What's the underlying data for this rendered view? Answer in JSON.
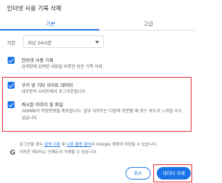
{
  "dialog": {
    "title": "인터넷 사용 기록 삭제"
  },
  "tabs": [
    {
      "label": "기본"
    },
    {
      "label": "고급"
    }
  ],
  "period": {
    "label": "기간",
    "value": "지난 24시간"
  },
  "items": [
    {
      "title": "인터넷 사용 기록",
      "sub": "검색창에 입력한 내용을 비롯한 방문 기록 삭제"
    },
    {
      "title": "쿠키 및 기타 사이트 데이터",
      "sub": "대부분의 사이트에서 로그아웃됩니다."
    },
    {
      "title": "캐시된 이미지 및 파일",
      "sub": "269MB의 저장용량을 확보합니다. 일부 사이트는 다음에 방문할 때 로드 속도가 느려질 수도 있습니다."
    }
  ],
  "info": {
    "line1_pre": "로그인할 경우 ",
    "link1": "검색 기록",
    "line1_mid": " 및 ",
    "link2": "다른 활동 형식",
    "line1_post": "이 Google 계정에 저장될 수 있습니다.",
    "line2": "이러한 데이터는 언제든지 삭제할 수 있습니다."
  },
  "buttons": {
    "cancel": "취소",
    "delete": "데이터 삭제"
  },
  "colors": {
    "accent": "#1a73e8",
    "highlight": "#e3262b"
  },
  "icons": {
    "checkbox": "check-icon",
    "google": "google-g-icon",
    "dropdown": "chevron-down-icon"
  }
}
